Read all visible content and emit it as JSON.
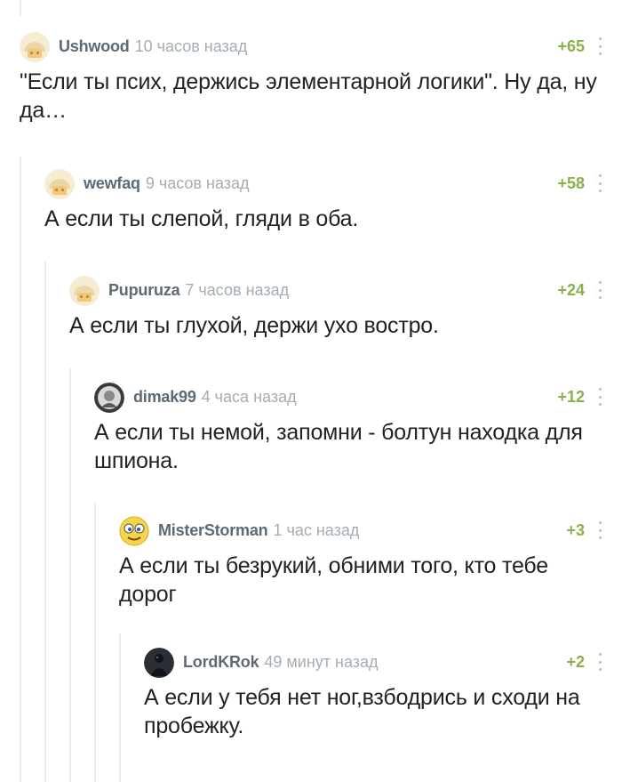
{
  "comments": [
    {
      "author": "Ushwood",
      "time": "10 часов назад",
      "rating": "+65",
      "text": "\"Если ты псих, держись элементарной логики\". Ну да, ну да…",
      "avatar": "default-avatar-icon"
    },
    {
      "author": "wewfaq",
      "time": "9 часов назад",
      "rating": "+58",
      "text": "А если ты слепой, гляди в оба.",
      "avatar": "default-avatar-icon"
    },
    {
      "author": "Pupuruza",
      "time": "7 часов назад",
      "rating": "+24",
      "text": "А если ты глухой, держи ухо востро.",
      "avatar": "default-avatar-icon"
    },
    {
      "author": "dimak99",
      "time": "4 часа назад",
      "rating": "+12",
      "text": "А если ты немой, запомни - болтун находка для шпиона.",
      "avatar": "user-photo-avatar"
    },
    {
      "author": "MisterStorman",
      "time": "1 час назад",
      "rating": "+3",
      "text": "А если ты безрукий, обними того, кто тебе дорог",
      "avatar": "smiley-avatar"
    },
    {
      "author": "LordKRok",
      "time": "49 минут назад",
      "rating": "+2",
      "text": "А если у тебя нет ног,взбодрись и сходи на пробежку.",
      "avatar": "dark-figure-avatar"
    }
  ],
  "colors": {
    "username": "#5c6a73",
    "time": "#a4adb3",
    "rating": "#8bb04a",
    "thread_line": "#e8ecee",
    "text": "#222222"
  }
}
